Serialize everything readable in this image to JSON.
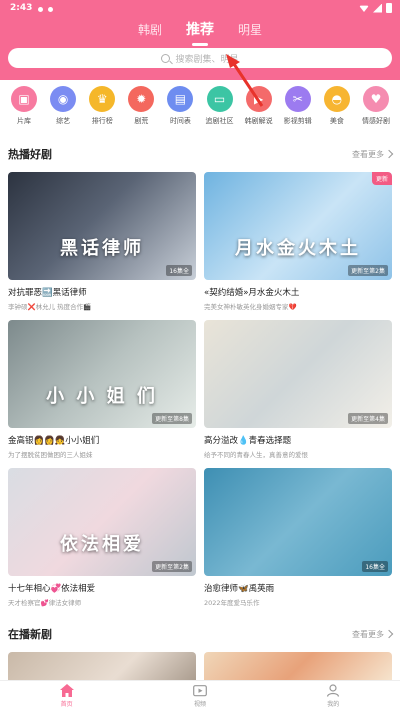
{
  "status_bar": {
    "time": "2:43"
  },
  "top_tabs": [
    {
      "label": "韩剧",
      "active": false
    },
    {
      "label": "推荐",
      "active": true
    },
    {
      "label": "明星",
      "active": false
    }
  ],
  "search": {
    "placeholder": "搜索剧集、明星"
  },
  "categories": [
    {
      "label": "片库",
      "icon": "film-library-icon",
      "color": "#f77aa0",
      "glyph": "▣"
    },
    {
      "label": "综艺",
      "icon": "variety-icon",
      "color": "#7b8cf2",
      "glyph": "◉"
    },
    {
      "label": "排行榜",
      "icon": "ranking-icon",
      "color": "#f5b72a",
      "glyph": "♛"
    },
    {
      "label": "剧荒",
      "icon": "fire-icon",
      "color": "#f4685e",
      "glyph": "✹"
    },
    {
      "label": "时间表",
      "icon": "calendar-icon",
      "color": "#6e8df0",
      "glyph": "▤"
    },
    {
      "label": "追剧社区",
      "icon": "tv-icon",
      "color": "#3cc5a4",
      "glyph": "▭"
    },
    {
      "label": "韩剧解说",
      "icon": "commentary-icon",
      "color": "#f46a6a",
      "glyph": "▶"
    },
    {
      "label": "影视剪辑",
      "icon": "clip-icon",
      "color": "#9c7bf0",
      "glyph": "✂"
    },
    {
      "label": "美食",
      "icon": "food-icon",
      "color": "#f7b531",
      "glyph": "◓"
    },
    {
      "label": "情感好剧",
      "icon": "heart-icon",
      "color": "#f58cb0",
      "glyph": "♥"
    }
  ],
  "hot_section": {
    "title": "热播好剧",
    "more": "查看更多"
  },
  "hot_dramas": [
    {
      "title": "对抗罪恶🔜黑话律师",
      "sub": "李钟硕❌林允儿 热度合作🎬",
      "poster_text": "黑话律师",
      "badge": "16集全",
      "corner": "",
      "bg": "linear-gradient(135deg,#2c3340 0%,#5a6475 45%,#c8cfd8 100%)"
    },
    {
      "title": "«契约结婚»月水金火木土",
      "sub": "完美女神朴敏英化身婚姻专家💔",
      "poster_text": "月水金火木土",
      "badge": "更新至第2集",
      "corner": "更新",
      "bg": "linear-gradient(135deg,#6fb3e0 0%,#c9e4f6 55%,#8fc3e8 100%)"
    },
    {
      "title": "金高银👩👩👧小小姐们",
      "sub": "为了摆脱贫困做困的三人姐妹",
      "poster_text": "小 小 姐 们",
      "badge": "更新至第8集",
      "corner": "",
      "bg": "linear-gradient(135deg,#7d8a8c 0%,#b7c2c0 50%,#e6ece8 100%)"
    },
    {
      "title": "高分溢改💧青春选择题",
      "sub": "给予不同的青春人生，真善意的爱恨",
      "poster_text": "",
      "badge": "更新至第4集",
      "corner": "",
      "bg": "linear-gradient(135deg,#e9e4d8 0%,#cfd6d8 50%,#f2efe8 100%)"
    },
    {
      "title": "十七年相心💞依法相爱",
      "sub": "天才检察官💕律法女律师",
      "poster_text": "依法相爱",
      "badge": "更新至第2集",
      "corner": "",
      "bg": "linear-gradient(135deg,#d9dde3 0%,#f0d9df 50%,#bfc7cf 100%)"
    },
    {
      "title": "治愈律师🦋禹英雨",
      "sub": "2022年度爱马乐作",
      "poster_text": "",
      "badge": "16集全",
      "corner": "",
      "bg": "linear-gradient(135deg,#3e8fb3 0%,#79b8d2 50%,#4b9cbd 100%)"
    }
  ],
  "airing_section": {
    "title": "在播新剧",
    "more": "查看更多"
  },
  "bottom_nav": [
    {
      "label": "首页",
      "active": true
    },
    {
      "label": "视频",
      "active": false
    },
    {
      "label": "我的",
      "active": false
    }
  ],
  "colors": {
    "brand": "#f76a93",
    "annotation_red": "#e8332b"
  }
}
